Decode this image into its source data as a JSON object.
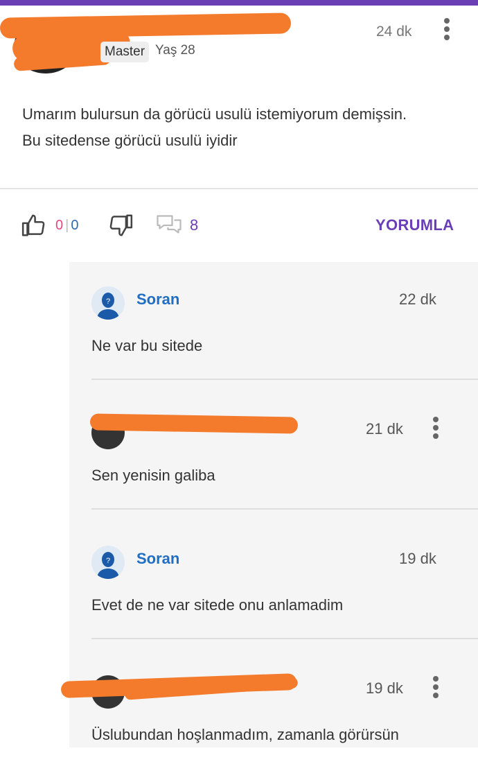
{
  "colors": {
    "brand": "#6a3fb5",
    "like": "#e8467c",
    "link": "#1f6ec4",
    "redaction": "#f47a2c"
  },
  "answer": {
    "badge": "Master",
    "age": "Yaş 28",
    "time": "24 dk",
    "body_line1": "Umarım bulursun da görücü usulü istemiyorum demişsin.",
    "body_line2": "Bu sitedense görücü usulü iyidir"
  },
  "actions": {
    "like_count": "0",
    "dislike_count": "0",
    "comment_count": "8",
    "reply_label": "YORUMLA"
  },
  "comments": [
    {
      "author": "Soran",
      "time": "22 dk",
      "text": "Ne var bu sitede"
    },
    {
      "author": "",
      "time": "21 dk",
      "text": "Sen yenisin galiba"
    },
    {
      "author": "Soran",
      "time": "19 dk",
      "text": "Evet de ne var sitede onu anlamadim"
    },
    {
      "author": "",
      "time": "19 dk",
      "text": "Üslubundan hoşlanmadım, zamanla görürsün"
    }
  ]
}
